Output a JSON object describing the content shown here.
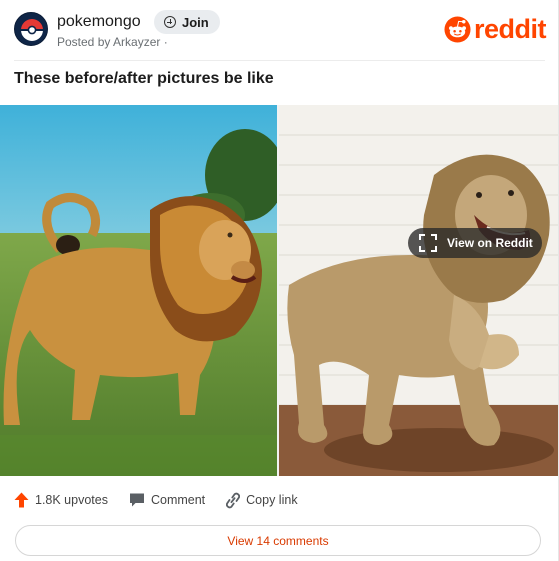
{
  "header": {
    "subreddit": "pokemongo",
    "join_label": "Join",
    "posted_by": "Posted by Arkayzer ·",
    "brand": "reddit"
  },
  "post": {
    "title": "These before/after pictures be like",
    "view_on_label": "View on Reddit"
  },
  "actions": {
    "upvotes": "1.8K upvotes",
    "comment": "Comment",
    "copy_link": "Copy link"
  },
  "footer": {
    "view_comments": "View 14 comments"
  },
  "colors": {
    "brand_orange": "#ff4500",
    "link_red": "#d93a00"
  }
}
